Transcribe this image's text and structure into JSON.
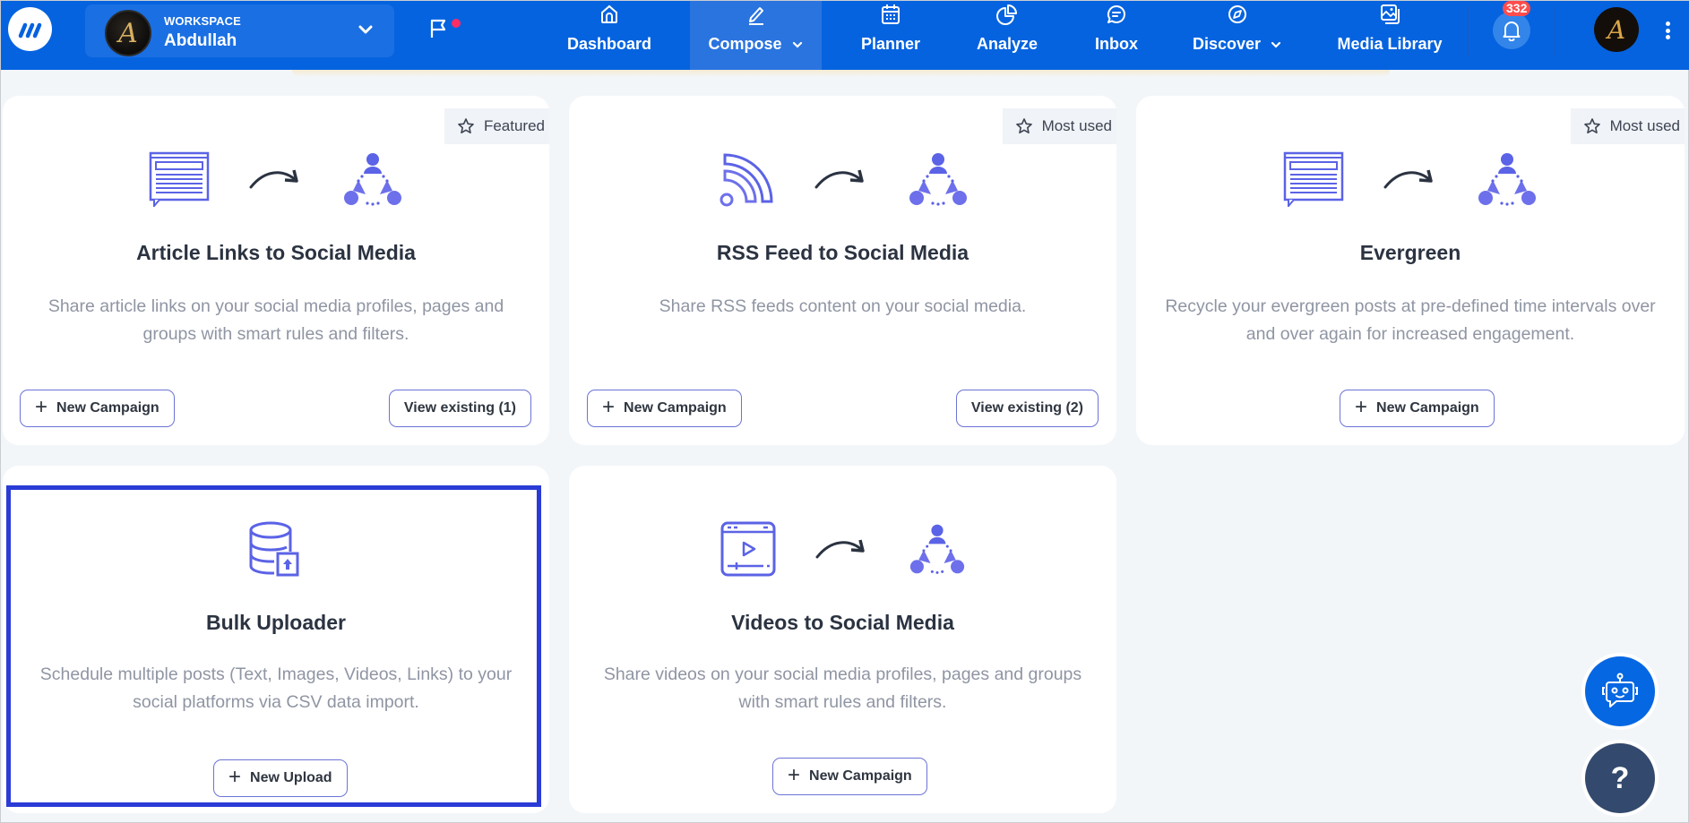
{
  "nav": {
    "workspace_label": "WORKSPACE",
    "workspace_name": "Abdullah",
    "items": [
      {
        "label": "Dashboard",
        "icon": "home-icon"
      },
      {
        "label": "Compose",
        "icon": "pencil-icon",
        "dropdown": true,
        "active": true
      },
      {
        "label": "Planner",
        "icon": "calendar-icon"
      },
      {
        "label": "Analyze",
        "icon": "pie-chart-icon"
      },
      {
        "label": "Inbox",
        "icon": "chat-icon"
      },
      {
        "label": "Discover",
        "icon": "compass-icon",
        "dropdown": true
      },
      {
        "label": "Media Library",
        "icon": "image-gallery-icon"
      }
    ],
    "notification_count": "332",
    "brand_color": "#0563df"
  },
  "cards": [
    {
      "title": "Article Links to Social Media",
      "description": "Share article links on your social media profiles, pages and groups with smart rules and filters.",
      "badge": "Featured",
      "primary_button": "New Campaign",
      "secondary_button": "View existing (1)"
    },
    {
      "title": "RSS Feed to Social Media",
      "description": "Share RSS feeds content on your social media.",
      "badge": "Most used",
      "primary_button": "New Campaign",
      "secondary_button": "View existing (2)"
    },
    {
      "title": "Evergreen",
      "description": "Recycle your evergreen posts at pre-defined time intervals over and over again for increased engagement.",
      "badge": "Most used",
      "primary_button": "New Campaign"
    },
    {
      "title": "Bulk Uploader",
      "description": "Schedule multiple posts (Text, Images, Videos, Links) to your social platforms via CSV data import.",
      "primary_button": "New Upload",
      "selected": true
    },
    {
      "title": "Videos to Social Media",
      "description": "Share videos on your social media profiles, pages and groups with smart rules and filters.",
      "primary_button": "New Campaign"
    }
  ],
  "help": {
    "label": "?"
  },
  "colors": {
    "accent": "#6b73d6",
    "illustration": "#5b63e6",
    "highlight": "#2a3bd6"
  }
}
